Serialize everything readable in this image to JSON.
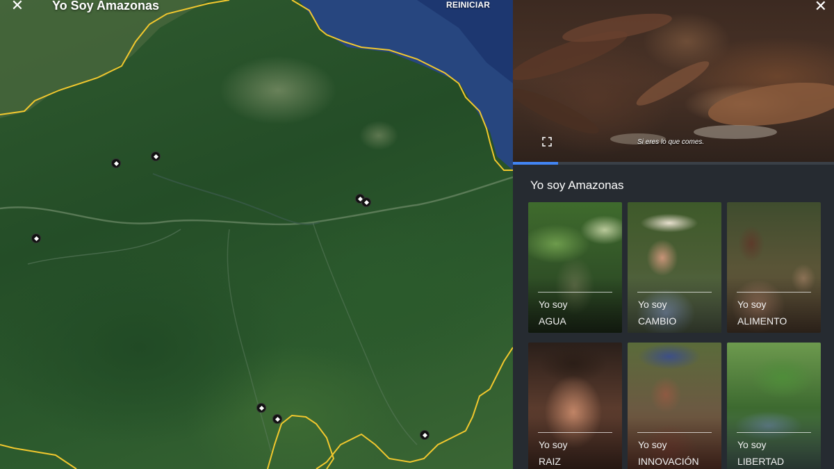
{
  "map": {
    "title": "Yo Soy Amazonas",
    "reset_label": "REINICIAR",
    "close_icon": "close-icon",
    "pins": [
      "place-pin",
      "place-pin",
      "place-pin",
      "place-pin",
      "place-pin",
      "place-pin",
      "place-pin",
      "place-pin",
      "place-pin"
    ]
  },
  "video": {
    "caption": "Si eres lo que comes.",
    "progress": 0.14,
    "progress_color": "#4285f4"
  },
  "panel": {
    "section_title": "Yo soy Amazonas",
    "cards": [
      {
        "line1": "Yo soy",
        "line2": "AGUA"
      },
      {
        "line1": "Yo soy",
        "line2": "CAMBIO"
      },
      {
        "line1": "Yo soy",
        "line2": "ALIMENTO"
      },
      {
        "line1": "Yo soy",
        "line2": "RAIZ"
      },
      {
        "line1": "Yo soy",
        "line2": "INNOVACIÓN"
      },
      {
        "line1": "Yo soy",
        "line2": "LIBERTAD"
      }
    ]
  },
  "colors": {
    "border_line": "#f2c82e",
    "ocean": "#2a4a8a",
    "panel_bg": "#262b31"
  }
}
